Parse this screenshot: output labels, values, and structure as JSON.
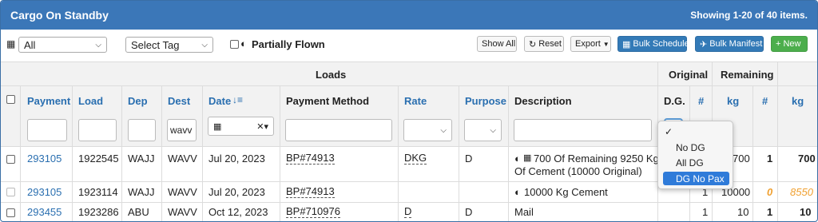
{
  "header": {
    "title": "Cargo On Standby",
    "summary": "Showing 1-20 of 40 items."
  },
  "toolbar": {
    "filter_select": "All",
    "tag_select": "Select Tag",
    "partially_flown_label": "Partially Flown",
    "show_all": "Show All",
    "reset": "Reset",
    "export": "Export",
    "bulk_schedule": "Bulk Schedule",
    "bulk_manifest": "Bulk Manifest",
    "new": "New"
  },
  "columns": {
    "groups": {
      "loads": "Loads",
      "original": "Original",
      "remaining": "Remaining"
    },
    "headers": [
      "Payment",
      "Load",
      "Dep",
      "Dest",
      "Date",
      "Payment Method",
      "Rate",
      "Purpose",
      "Description",
      "D.G.",
      "#",
      "kg",
      "#",
      "kg"
    ]
  },
  "filters": {
    "dest_value": "wavv"
  },
  "dg_dropdown": {
    "options": [
      "No DG",
      "All DG",
      "DG No Pax"
    ],
    "checked_index": -1,
    "highlighted_index": 2
  },
  "rows": [
    {
      "payment": "293105",
      "load": "1922545",
      "dep": "WAJJ",
      "dest": "WAVV",
      "date": "Jul 20, 2023",
      "method": "BP#74913",
      "rate": "DKG",
      "purpose": "D",
      "desc_line1": "700 Of Remaining 9250 Kg",
      "desc_line2": "Of Cement (10000 Original)",
      "orig_count": "",
      "orig_kg": "700",
      "rem_count": "1",
      "rem_kg": "700"
    },
    {
      "payment": "293105",
      "load": "1923114",
      "dep": "WAJJ",
      "dest": "WAVV",
      "date": "Jul 20, 2023",
      "method": "BP#74913",
      "rate": "",
      "purpose": "",
      "desc_line1": "10000 Kg Cement",
      "desc_line2": "",
      "orig_count": "1",
      "orig_kg": "10000",
      "rem_count": "0",
      "rem_kg": "8550"
    },
    {
      "payment": "293455",
      "load": "1923286",
      "dep": "ABU",
      "dest": "WAVV",
      "date": "Oct 12, 2023",
      "method": "BP#710976",
      "rate": "D",
      "purpose": "D",
      "desc_line1": "Mail",
      "desc_line2": "",
      "orig_count": "1",
      "orig_kg": "10",
      "rem_count": "1",
      "rem_kg": "10"
    }
  ],
  "colors": {
    "title_bar": "#3b77b8",
    "link": "#2a6fb0",
    "orange": "#f0a030",
    "highlight": "#2f7bd9"
  }
}
